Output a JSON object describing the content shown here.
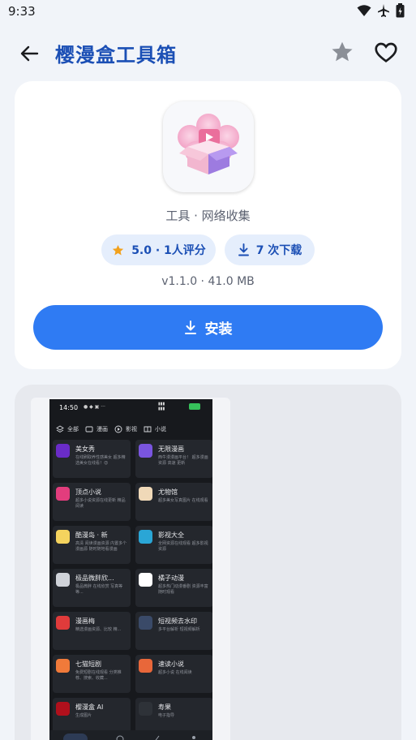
{
  "status_bar": {
    "time": "9:33"
  },
  "app_bar": {
    "title": "樱漫盒工具箱"
  },
  "app": {
    "category": "工具 · 网络收集",
    "rating_chip": "5.0 · 1人评分",
    "downloads_chip": "7 次下载",
    "meta": "v1.1.0 · 41.0 MB",
    "install_label": "安装"
  },
  "colors": {
    "accent": "#2f7bf3",
    "title": "#1b4fb5",
    "chip_bg": "#e5eefc",
    "star": "#f2a11c"
  },
  "screenshot": {
    "time": "14:50",
    "tabs": [
      {
        "label": "全部",
        "icon": "layers-icon"
      },
      {
        "label": "漫画",
        "icon": "image-icon"
      },
      {
        "label": "影视",
        "icon": "play-icon"
      },
      {
        "label": "小说",
        "icon": "book-icon"
      }
    ],
    "items": [
      {
        "name": "美女秀",
        "desc": "在线刷取养性感美女 超多精选美女在线看！😍",
        "color": "#6a2cc8"
      },
      {
        "name": "无限漫画",
        "desc": "西牛漫漫画平台！ 超多漫画资源 高速 更新",
        "color": "#7a55e0"
      },
      {
        "name": "顶点小说",
        "desc": "超多小说资源在线更新 精品阅读",
        "color": "#e23d7d"
      },
      {
        "name": "尤物馆",
        "desc": "超多美女写真图片 在线观看",
        "color": "#f0d9b8"
      },
      {
        "name": "酷漫岛 · 新",
        "desc": "高清 阅读漫画资源 内置多个漫画源 随时随地看漫画",
        "color": "#f4d35e"
      },
      {
        "name": "影视大全",
        "desc": "全网资源在线观看 超多影视资源",
        "color": "#2aa6d6"
      },
      {
        "name": "极品微胖欣...",
        "desc": "极品微胖 在线欣赏 写真等等...",
        "color": "#cfd2d8"
      },
      {
        "name": "橘子动漫",
        "desc": "超多热门动漫番剧 资源丰富 随时观看",
        "color": "#ffffff"
      },
      {
        "name": "漫画梅",
        "desc": "精选漫画资源、比较 精...",
        "color": "#e03b3b"
      },
      {
        "name": "短视频去水印",
        "desc": "多平台解析 短视频解析",
        "color": "#3a4a68"
      },
      {
        "name": "七猫短剧",
        "desc": "免费短剧在线观看 分类推荐、搜索、收藏...",
        "color": "#f07a3a"
      },
      {
        "name": "速读小说",
        "desc": "超多小说 在线阅读",
        "color": "#e8673a"
      },
      {
        "name": "樱漫盒 AI",
        "desc": "生成图片",
        "color": "#b0101c"
      },
      {
        "name": "寿果",
        "desc": "电子指导",
        "color": "#2e3238"
      }
    ]
  }
}
